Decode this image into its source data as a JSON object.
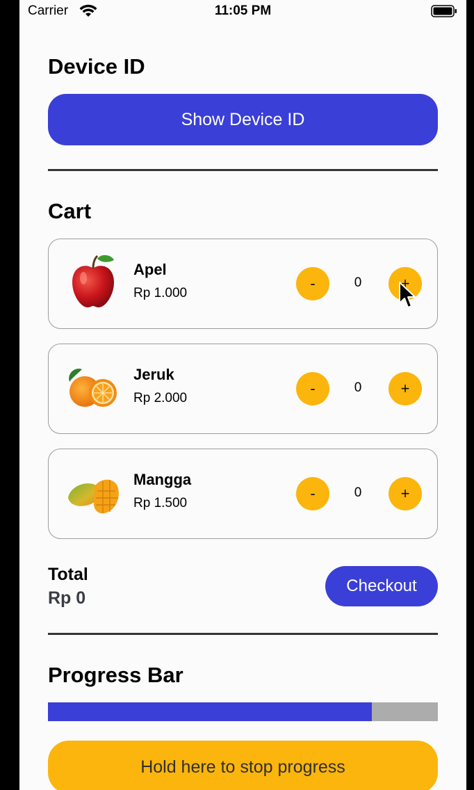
{
  "status_bar": {
    "carrier": "Carrier",
    "time": "11:05 PM"
  },
  "device_section": {
    "title": "Device ID",
    "button_label": "Show Device ID"
  },
  "cart_section": {
    "title": "Cart",
    "items": [
      {
        "name": "Apel",
        "price": "Rp 1.000",
        "quantity": "0",
        "icon": "apple-icon"
      },
      {
        "name": "Jeruk",
        "price": "Rp 2.000",
        "quantity": "0",
        "icon": "orange-icon"
      },
      {
        "name": "Mangga",
        "price": "Rp 1.500",
        "quantity": "0",
        "icon": "mango-icon"
      }
    ],
    "minus_label": "-",
    "plus_label": "+",
    "total_label": "Total",
    "total_value": "Rp 0",
    "checkout_label": "Checkout"
  },
  "progress_section": {
    "title": "Progress Bar",
    "progress_percent": 83,
    "hold_button_label": "Hold here to stop progress"
  },
  "colors": {
    "primary": "#3a3fd8",
    "accent": "#fbb50c",
    "progress_track": "#acacac",
    "background": "#fbfbfb"
  }
}
